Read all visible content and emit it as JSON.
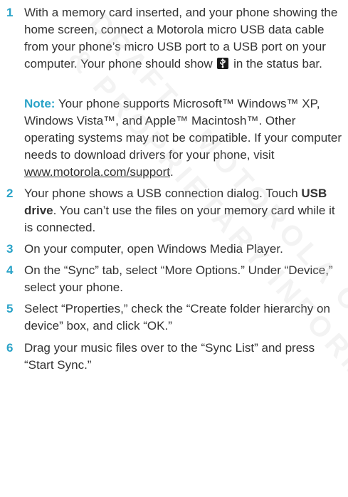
{
  "steps": [
    {
      "number": "1",
      "text_a": "With a memory card inserted, and your phone showing the home screen, connect a Motorola micro USB data cable from your phone’s micro USB port to a USB port on your computer. Your phone should show ",
      "text_b": " in the status bar."
    },
    {
      "note_label": "Note:",
      "note_text_a": " Your phone supports Microsoft™ Windows™ XP, Windows Vista™, and Apple™ Macintosh™. Other operating systems may not be compatible. If your computer needs to download drivers for your phone, visit ",
      "note_link": "www.motorola.com/support",
      "note_text_b": "."
    },
    {
      "number": "2",
      "text_a": "Your phone shows a USB connection dialog. Touch ",
      "bold": "USB drive",
      "text_b": ". You can’t use the files on your memory card while it is connected."
    },
    {
      "number": "3",
      "text": "On your computer, open Windows Media Player."
    },
    {
      "number": "4",
      "text": "On the “Sync” tab, select “More Options.” Under “Device,” select your phone."
    },
    {
      "number": "5",
      "text": "Select “Properties,” check the “Create folder hierarchy on device” box, and click “OK.”"
    },
    {
      "number": "6",
      "text": "Drag your music files over to the “Sync List” and press “Start Sync.”"
    }
  ],
  "icon": "usb-connected-icon",
  "colors": {
    "accent": "#2aa3c8",
    "text": "#333333"
  },
  "watermark": [
    "DRAFT - MOTOROLA CONFIDENTIAL",
    "& PROPRIETARY INFORMATION"
  ]
}
